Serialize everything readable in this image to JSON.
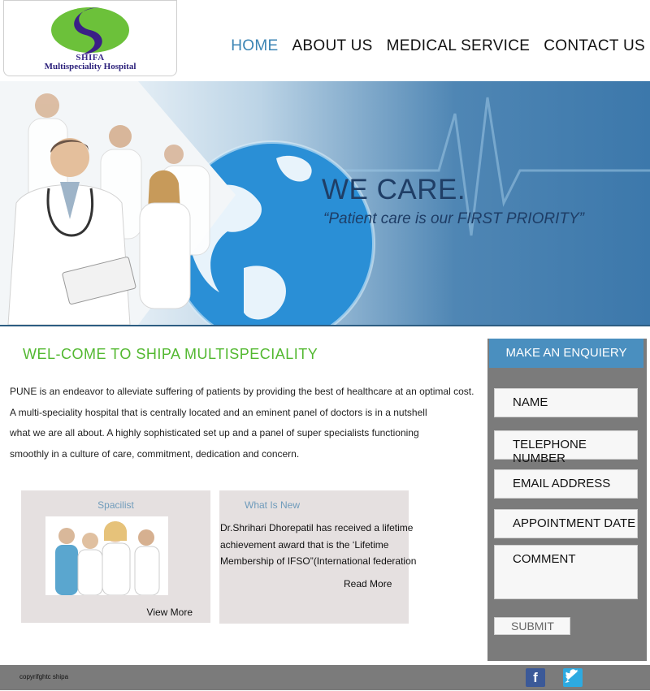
{
  "logo": {
    "title": "SHIFA",
    "subtitle": "Multispeciality Hospital"
  },
  "nav": {
    "items": [
      {
        "label": "HOME",
        "active": true
      },
      {
        "label": "ABOUT US",
        "active": false
      },
      {
        "label": "MEDICAL SERVICE",
        "active": false
      },
      {
        "label": "CONTACT US",
        "active": false
      }
    ]
  },
  "banner": {
    "headline": "WE CARE.",
    "tagline": "“Patient care is our FIRST PRIORITY”"
  },
  "welcome": {
    "title": "WEL-COME TO SHIPA MULTISPECIALITY",
    "lines": [
      "  PUNE is an endeavor to alleviate suffering of patients   by providing the best of healthcare at an optimal cost.",
      " A multi-speciality hospital that is centrally located     and an eminent panel of doctors is in a nutshell",
      " what we are all about. A highly sophisticated set up and a panel of super specialists functioning",
      "smoothly in a culture of care, commitment, dedication and concern."
    ]
  },
  "cards": {
    "specialist": {
      "title": "Spacilist",
      "link": "View More"
    },
    "news": {
      "title": "What Is New",
      "lines": [
        "Dr.Shrihari Dhorepatil has received a lifetime",
        " achievement award that is the ‘Lifetime",
        "Membership of IFSO”(International federation"
      ],
      "link": "Read More"
    }
  },
  "enquiry": {
    "title": "MAKE AN ENQUIERY",
    "fields": {
      "name": "NAME",
      "telephone": "TELEPHONE NUMBER",
      "email": "EMAIL ADDRESS",
      "date": "APPOINTMENT DATE",
      "comment": "COMMENT"
    },
    "submit": "SUBMIT"
  },
  "footer": {
    "copyright": "copyrifghtc shipa"
  },
  "colors": {
    "accent_blue": "#3b84b4",
    "brand_green": "#52b830",
    "panel_gray": "#7b7b7b",
    "header_blue": "#4a8fbf"
  },
  "icons": {
    "facebook": "facebook-icon",
    "twitter": "twitter-icon"
  }
}
